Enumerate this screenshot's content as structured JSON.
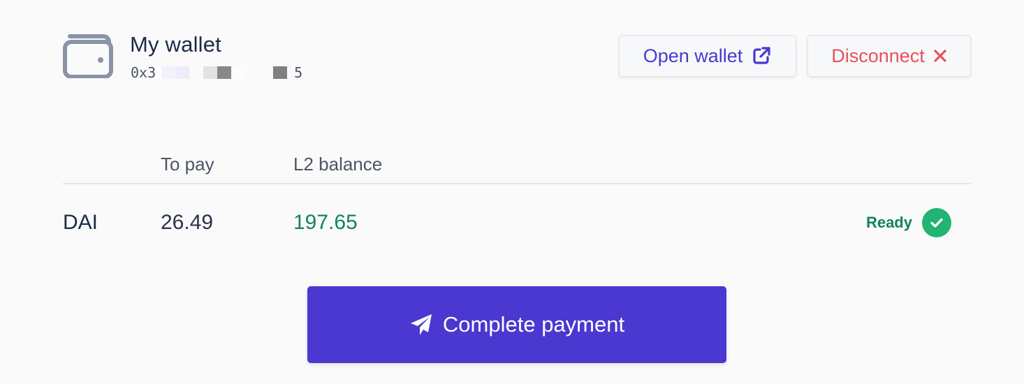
{
  "wallet": {
    "title": "My wallet",
    "address_prefix": "0x3",
    "address_suffix": "5",
    "icon": "wallet-icon"
  },
  "actions": {
    "open_label": "Open wallet",
    "open_icon": "external-link-icon",
    "disconnect_label": "Disconnect",
    "disconnect_icon": "close-icon"
  },
  "table": {
    "headers": [
      "",
      "To pay",
      "L2 balance"
    ],
    "rows": [
      {
        "token": "DAI",
        "to_pay": "26.49",
        "balance": "197.65",
        "status": "Ready"
      }
    ]
  },
  "payment": {
    "label": "Complete payment",
    "icon": "paper-plane-icon"
  },
  "colors": {
    "accent": "#4a38d0",
    "danger": "#e9505c",
    "success": "#11845b",
    "success_badge": "#22b473"
  }
}
